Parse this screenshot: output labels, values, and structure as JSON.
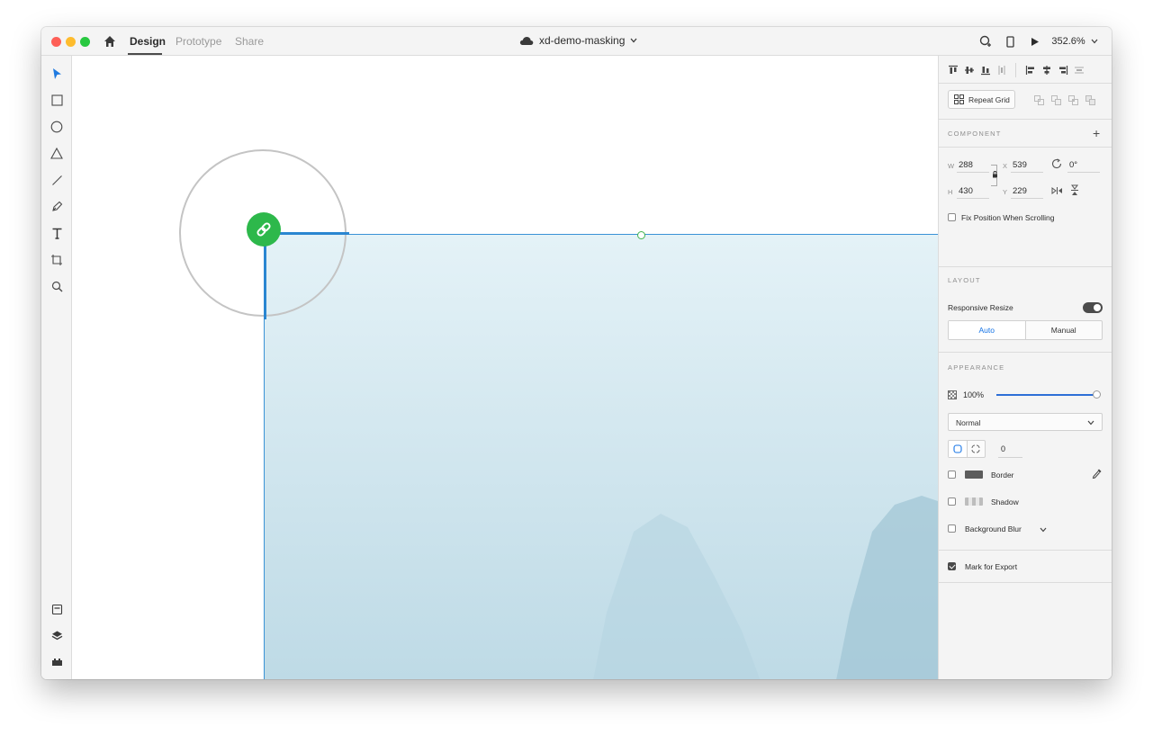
{
  "titlebar": {
    "tabs": [
      {
        "label": "Design",
        "active": true
      },
      {
        "label": "Prototype",
        "active": false
      },
      {
        "label": "Share",
        "active": false
      }
    ],
    "document_title": "xd-demo-masking",
    "zoom": "352.6%"
  },
  "toolbar": {
    "tools": [
      "select-tool",
      "rectangle-tool",
      "ellipse-tool",
      "polygon-tool",
      "line-tool",
      "pen-tool",
      "text-tool",
      "artboard-tool",
      "zoom-tool"
    ],
    "bottom_tools": [
      "assets-panel",
      "layers-panel",
      "plugins-panel"
    ]
  },
  "panel": {
    "repeat_grid_label": "Repeat Grid",
    "component": {
      "title": "COMPONENT",
      "add": "+"
    },
    "transform": {
      "w_label": "W",
      "w": "288",
      "x_label": "X",
      "x": "539",
      "rotation": "0°",
      "h_label": "H",
      "h": "430",
      "y_label": "Y",
      "y": "229",
      "fix_position_label": "Fix Position When Scrolling",
      "fix_position_checked": false
    },
    "layout": {
      "title": "LAYOUT",
      "responsive_resize_label": "Responsive Resize",
      "responsive_resize_on": true,
      "modes": [
        "Auto",
        "Manual"
      ],
      "active_mode": "Auto"
    },
    "appearance": {
      "title": "APPEARANCE",
      "opacity": "100%",
      "opacity_value": 1.0,
      "blend_mode": "Normal",
      "corner_radius": "0",
      "border_label": "Border",
      "border_checked": false,
      "shadow_label": "Shadow",
      "shadow_checked": false,
      "background_blur_label": "Background Blur",
      "background_blur_checked": false
    },
    "export": {
      "mark_for_export_label": "Mark for Export",
      "mark_for_export_checked": true
    }
  },
  "colors": {
    "selection": "#3a93d6",
    "link_badge": "#2db84b",
    "accent": "#1473e6"
  }
}
